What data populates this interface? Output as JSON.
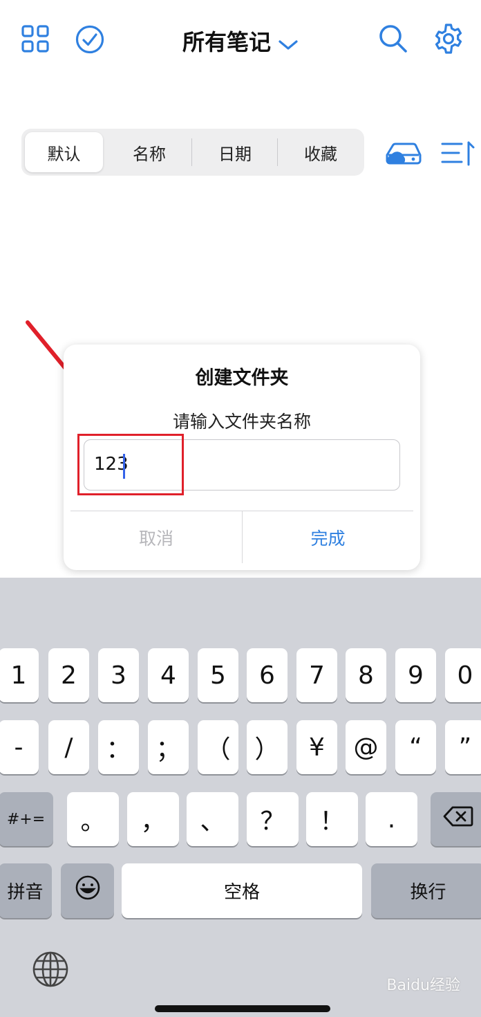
{
  "header": {
    "title": "所有笔记",
    "icons": [
      "grid-icon",
      "check-circle-icon",
      "chevron-down-icon",
      "search-icon",
      "gear-icon"
    ]
  },
  "sort_tabs": [
    {
      "label": "默认",
      "active": true
    },
    {
      "label": "名称",
      "active": false
    },
    {
      "label": "日期",
      "active": false
    },
    {
      "label": "收藏",
      "active": false
    }
  ],
  "toolbar_icons": [
    "cloud-drive-icon",
    "sort-list-icon"
  ],
  "dialog": {
    "title": "创建文件夹",
    "message": "请输入文件夹名称",
    "input_value": "123",
    "cancel_label": "取消",
    "done_label": "完成"
  },
  "keyboard": {
    "row1": [
      "1",
      "2",
      "3",
      "4",
      "5",
      "6",
      "7",
      "8",
      "9",
      "0"
    ],
    "row2": [
      "-",
      "/",
      "：",
      "；",
      "（",
      "）",
      "¥",
      "@",
      "“",
      "”"
    ],
    "row3_left": "#+=",
    "row3": [
      "。",
      "，",
      "、",
      "？",
      "！",
      "."
    ],
    "pinyin_label": "拼音",
    "space_label": "空格",
    "return_label": "换行"
  },
  "watermark": "Baidu经验",
  "colors": {
    "accent": "#2f80e0",
    "highlight": "#e0202a"
  }
}
